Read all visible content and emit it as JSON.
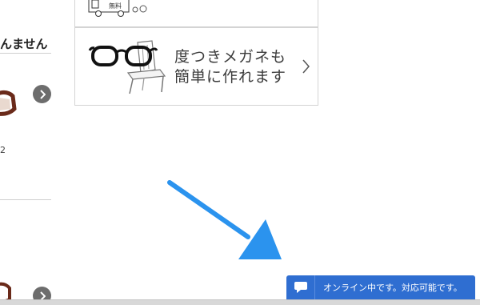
{
  "left_column": {
    "heading": "んません",
    "number_fragment": "2"
  },
  "panel": {
    "truck_label": "無料",
    "line1": "度つきメガネも",
    "line2": "簡単に作れます"
  },
  "chat_widget": {
    "status_text": "オンライン中です。対応可能です。",
    "color": "#2f6ed1"
  },
  "colors": {
    "annotation_arrow": "#2b93ee",
    "circle_button": "#6d6d6d",
    "border": "#d4d4d4"
  }
}
